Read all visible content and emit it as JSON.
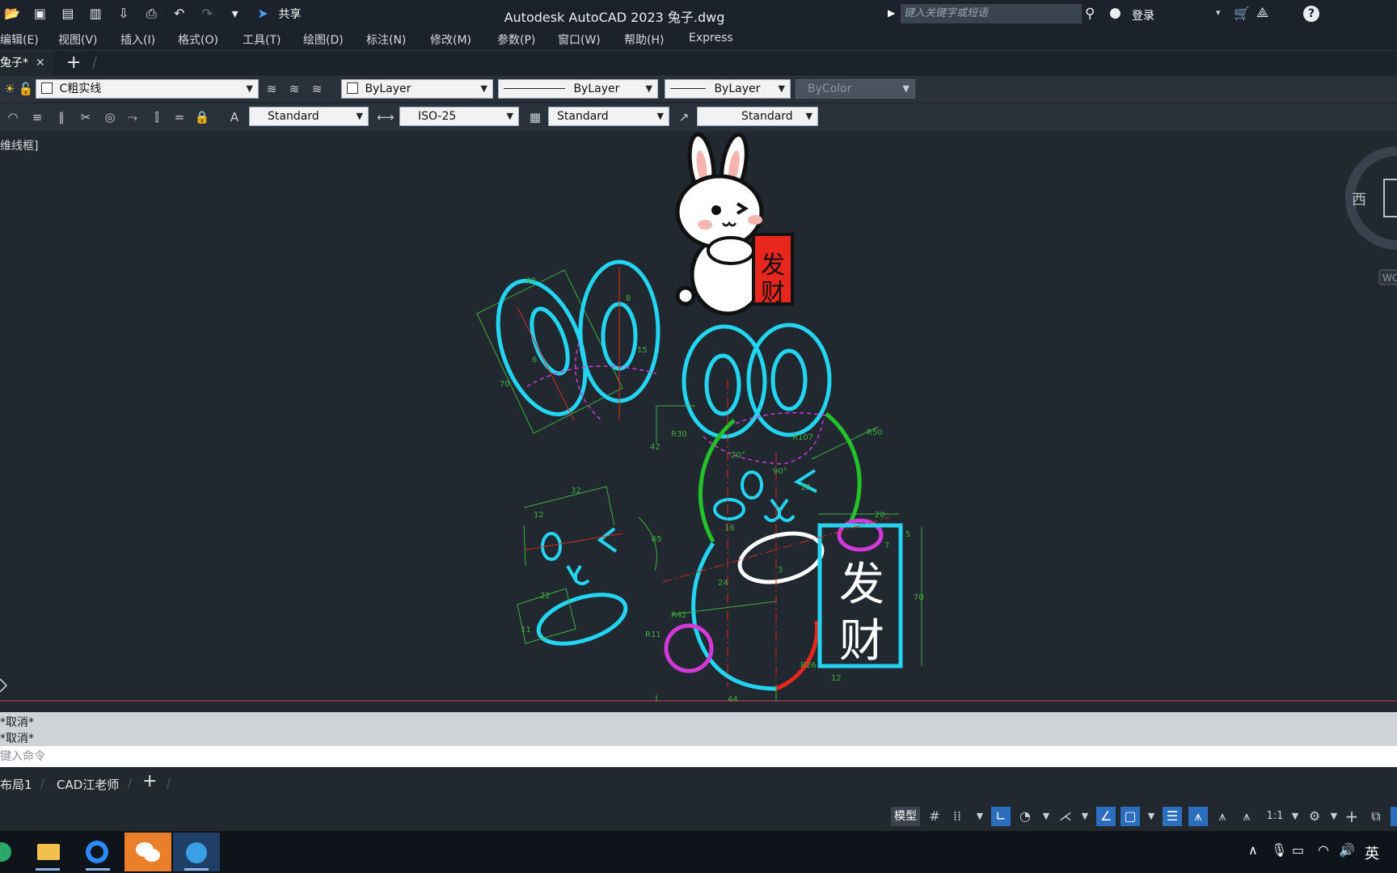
{
  "titlebar": {
    "app_title": "Autodesk AutoCAD 2023    兔子.dwg",
    "share_label": "共享",
    "search_placeholder": "键入关键字或短语",
    "login_label": "登录"
  },
  "menu": {
    "items": [
      "编辑(E)",
      "视图(V)",
      "插入(I)",
      "格式(O)",
      "工具(T)",
      "绘图(D)",
      "标注(N)",
      "修改(M)",
      "参数(P)",
      "窗口(W)",
      "帮助(H)",
      "Express"
    ]
  },
  "tabs": {
    "doc_tab": "兔子*"
  },
  "toolbar1": {
    "layer": "C粗实线",
    "color": "ByLayer",
    "linetype": "ByLayer",
    "lineweight": "ByLayer",
    "plotstyle": "ByColor"
  },
  "toolbar2": {
    "text_style": "Standard",
    "dim_style": "ISO-25",
    "table_style": "Standard",
    "mleader_style": "Standard"
  },
  "viewport": {
    "label": "[-][俯视][二维线框]",
    "label_visible": "维线框]",
    "viewcube_west": "西",
    "wcs": "WCS"
  },
  "drawing": {
    "sticker_text_1": "发",
    "sticker_text_2": "财",
    "sign_text_1": "发",
    "sign_text_2": "财",
    "dims": {
      "d40": "40",
      "d8": "8",
      "d15": "15",
      "d70": "70",
      "d6": "6",
      "d42": "42",
      "R30": "R30",
      "R107": "R107",
      "R50": "R50",
      "a20": "20°",
      "a90": "90°",
      "d10": "10",
      "d16": "16",
      "d20": "20",
      "d5": "5",
      "d7": "7",
      "d24": "24",
      "d3": "3",
      "R42": "R42",
      "R11": "R11",
      "R26": "R26",
      "d44": "44",
      "d12": "12",
      "d32": "32",
      "d22": "22",
      "d11": "11",
      "d65": "65"
    }
  },
  "command": {
    "history": [
      "*取消*",
      "*取消*"
    ],
    "placeholder": "键入命令"
  },
  "layout_tabs": {
    "items": [
      "布局1",
      "CAD江老师"
    ]
  },
  "status": {
    "model_label": "模型",
    "scale": "1:1"
  },
  "tray": {
    "ime": "英"
  },
  "colors": {
    "cyan": "#23d5f0",
    "green": "#22c22a",
    "magenta": "#d13ad6",
    "red_line": "#d82a1e",
    "dim_green": "#3fb03f",
    "white": "#ffffff",
    "canvas_bg": "#212830"
  }
}
